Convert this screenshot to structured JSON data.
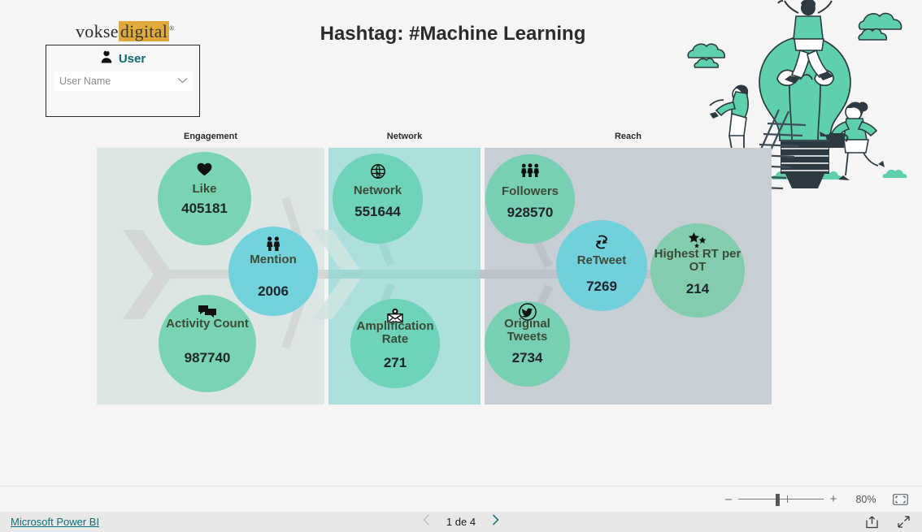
{
  "logo": {
    "part1": "vokse",
    "part2": "digital",
    "trademark": "®",
    "highlight_color": "#e0a93a"
  },
  "slicer": {
    "icon": "person-icon",
    "title": "User",
    "title_color": "#0d6b72",
    "dropdown_value": "User Name",
    "chevron": "chevron-down-icon"
  },
  "header": {
    "title": "Hashtag: #Machine Learning"
  },
  "illustration": {
    "name": "lightbulb-teamwork-illustration",
    "accent_color": "#5fd0ae"
  },
  "sections": [
    {
      "key": "engagement",
      "label": "Engagement",
      "bg": "#dde5e5"
    },
    {
      "key": "network",
      "label": "Network",
      "bg": "#ade0dd"
    },
    {
      "key": "reach",
      "label": "Reach",
      "bg": "#c7ced4"
    }
  ],
  "bubbles": {
    "like": {
      "label": "Like",
      "value": "405181",
      "icon": "heart-icon",
      "color": "#79d4b4",
      "section": "Engagement"
    },
    "mention": {
      "label": "Mention",
      "value": "2006",
      "icon": "two-people-icon",
      "color": "#72d3dc",
      "section": "Engagement"
    },
    "activity": {
      "label": "Activity Count",
      "value": "987740",
      "icon": "chat-bubbles-icon",
      "color": "#79d4b4",
      "section": "Engagement"
    },
    "network": {
      "label": "Network",
      "value": "551644",
      "icon": "globe-icon",
      "color": "#6ed3b8",
      "section": "Network"
    },
    "amplification": {
      "label": "Amplification Rate",
      "value": "271",
      "icon": "envelope-icon",
      "color": "#6ed3b8",
      "section": "Network"
    },
    "followers": {
      "label": "Followers",
      "value": "928570",
      "icon": "three-people-icon",
      "color": "#77cfb4",
      "section": "Reach"
    },
    "retweet": {
      "label": "ReTweet",
      "value": "7269",
      "icon": "refresh-icon",
      "color": "#72cfdc",
      "section": "Reach"
    },
    "highest_rt": {
      "label": "Highest RT per OT",
      "value": "214",
      "icon": "stars-icon",
      "color": "#83ccae",
      "section": "Reach"
    },
    "original": {
      "label": "Original Tweets",
      "value": "2734",
      "icon": "twitter-icon",
      "color": "#77cfb4",
      "section": "Reach"
    }
  },
  "chart_data": {
    "type": "bar",
    "title": "Hashtag: #Machine Learning",
    "xlabel": "",
    "ylabel": "",
    "categories": [
      "Like",
      "Mention",
      "Activity Count",
      "Network",
      "Amplification Rate",
      "Followers",
      "ReTweet",
      "Highest RT per OT",
      "Original Tweets"
    ],
    "values": [
      405181,
      2006,
      987740,
      551644,
      271,
      928570,
      7269,
      214,
      2734
    ],
    "groups": [
      "Engagement",
      "Engagement",
      "Engagement",
      "Network",
      "Network",
      "Reach",
      "Reach",
      "Reach",
      "Reach"
    ]
  },
  "zoom_bar": {
    "minus": "–",
    "plus": "+",
    "level": "80%",
    "fit_icon": "fit-to-page-icon"
  },
  "footer": {
    "brand_link": "Microsoft Power BI",
    "page_text": "1 de 4",
    "prev_icon": "chevron-left-icon",
    "next_icon": "chevron-right-icon",
    "share_icon": "share-icon",
    "fullscreen_icon": "fullscreen-icon"
  }
}
